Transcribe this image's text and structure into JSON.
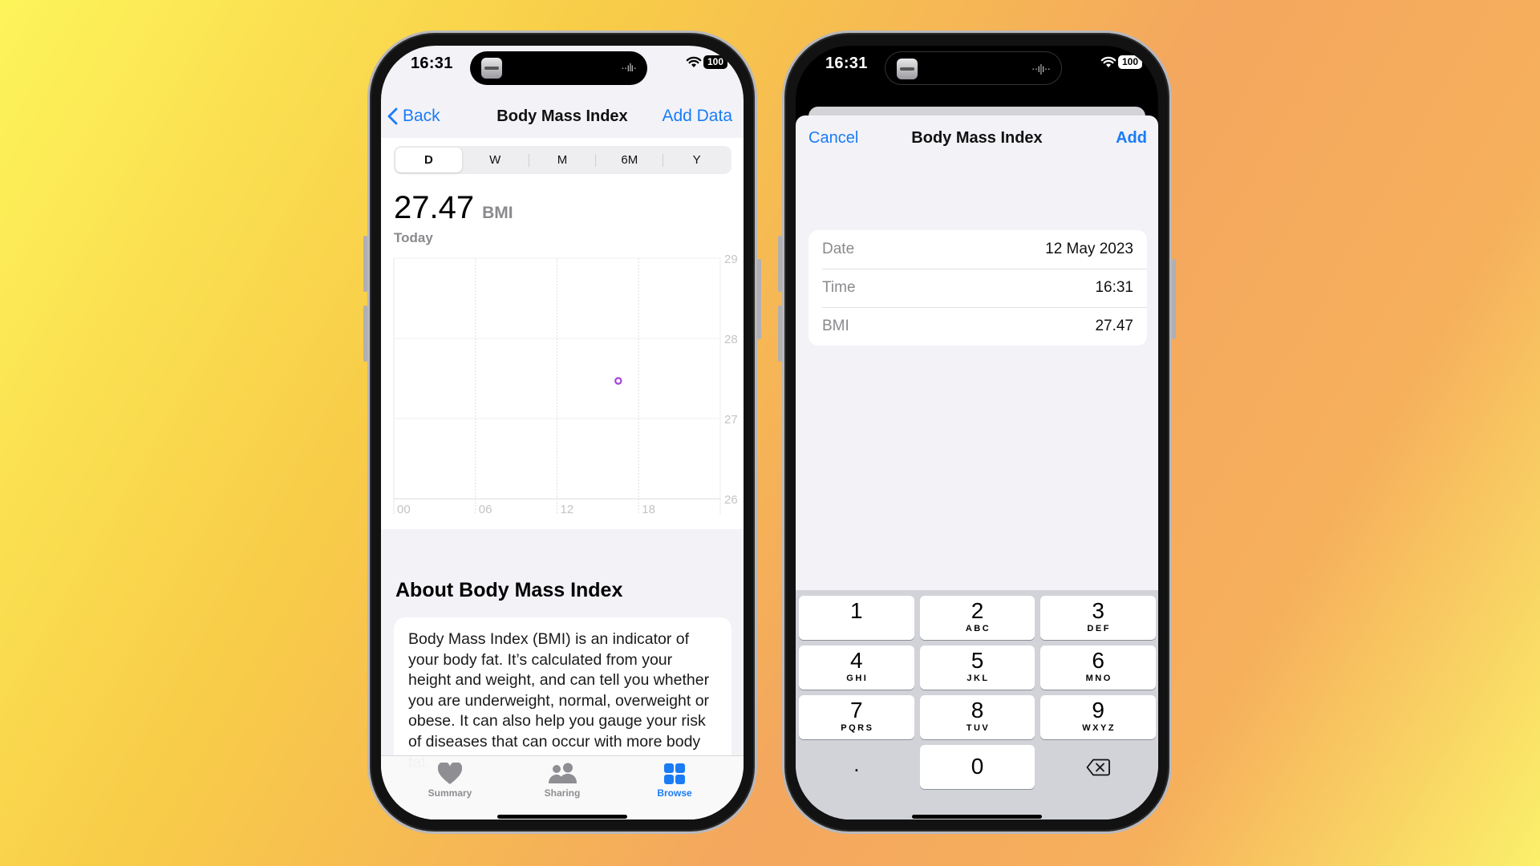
{
  "background": {
    "gradient": [
      "#fdf45a",
      "#f8cc48",
      "#f4a75e",
      "#fbf06a"
    ]
  },
  "left_phone": {
    "status_bar": {
      "time": "16:31",
      "battery": "100",
      "wave_glyph": "··ılı·"
    },
    "nav": {
      "back_label": "Back",
      "title": "Body Mass Index",
      "action_label": "Add Data"
    },
    "segments": [
      {
        "label": "D",
        "active": true
      },
      {
        "label": "W",
        "active": false
      },
      {
        "label": "M",
        "active": false
      },
      {
        "label": "6M",
        "active": false
      },
      {
        "label": "Y",
        "active": false
      }
    ],
    "summary": {
      "value": "27.47",
      "unit": "BMI",
      "period": "Today"
    },
    "about": {
      "title": "About Body Mass Index",
      "body": "Body Mass Index (BMI) is an indicator of your body fat. It’s calculated from your height and weight, and can tell you whether you are underweight, normal, overweight or obese. It can also help you gauge your risk of diseases that can occur with more body fat."
    },
    "tabbar": [
      {
        "label": "Summary",
        "icon": "heart-icon",
        "active": false
      },
      {
        "label": "Sharing",
        "icon": "people-icon",
        "active": false
      },
      {
        "label": "Browse",
        "icon": "grid-icon",
        "active": true
      }
    ]
  },
  "chart_data": {
    "type": "scatter",
    "title": "",
    "xlabel": "",
    "ylabel": "",
    "x_ticks": [
      "00",
      "06",
      "12",
      "18"
    ],
    "y_ticks": [
      29,
      28,
      27,
      26
    ],
    "xlim": [
      0,
      24
    ],
    "ylim": [
      26,
      29
    ],
    "grid": true,
    "series": [
      {
        "name": "BMI",
        "color": "#a445d9",
        "points": [
          {
            "x": 16.5,
            "y": 27.47
          }
        ]
      }
    ]
  },
  "right_phone": {
    "status_bar": {
      "time": "16:31",
      "battery": "100",
      "wave_glyph": "··ı|ı··"
    },
    "nav": {
      "cancel_label": "Cancel",
      "title": "Body Mass Index",
      "add_label": "Add"
    },
    "form": [
      {
        "label": "Date",
        "value": "12 May 2023"
      },
      {
        "label": "Time",
        "value": "16:31"
      },
      {
        "label": "BMI",
        "value": "27.47"
      }
    ],
    "keypad": {
      "rows": [
        [
          {
            "num": "1",
            "letters": ""
          },
          {
            "num": "2",
            "letters": "ABC"
          },
          {
            "num": "3",
            "letters": "DEF"
          }
        ],
        [
          {
            "num": "4",
            "letters": "GHI"
          },
          {
            "num": "5",
            "letters": "JKL"
          },
          {
            "num": "6",
            "letters": "MNO"
          }
        ],
        [
          {
            "num": "7",
            "letters": "PQRS"
          },
          {
            "num": "8",
            "letters": "TUV"
          },
          {
            "num": "9",
            "letters": "WXYZ"
          }
        ]
      ],
      "decimal": ".",
      "zero": "0",
      "delete_icon": "delete-backspace-icon"
    }
  }
}
